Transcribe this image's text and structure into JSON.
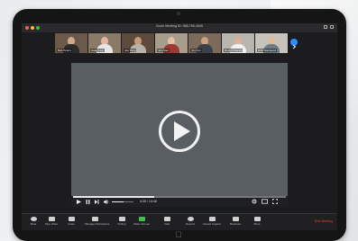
{
  "window": {
    "title": "Zoom Meeting ID: 968-795-4949"
  },
  "participants": [
    {
      "name": "Bob Peters",
      "bg": "#6b5a4c",
      "skin": "#d4a98a",
      "shirt": "#2b2b2b"
    },
    {
      "name": "Haley Lee",
      "bg": "#8a7a68",
      "skin": "#e2b79a",
      "shirt": "#e8e6e3"
    },
    {
      "name": "Joe Yang",
      "bg": "#5c4a3d",
      "skin": "#c89a7a",
      "shirt": "#b8b2aa"
    },
    {
      "name": "Jen Allen",
      "bg": "#a89c8c",
      "skin": "#e4bfa4",
      "shirt": "#9c3a32"
    },
    {
      "name": "Jon Kim",
      "bg": "#7c6b5c",
      "skin": "#cda080",
      "shirt": "#3c4048"
    },
    {
      "name": "Dustin Friends",
      "bg": "#b8b4ae",
      "skin": "#dcb094",
      "shirt": "#f2f2f2"
    },
    {
      "name": "Rick Stanwood",
      "bg": "#c6c2bc",
      "skin": "#e0b89a",
      "shirt": "#6f7a86"
    }
  ],
  "player": {
    "time": "4:35 / 14:46",
    "progress": 0.38,
    "volume": 0.55
  },
  "toolbar": {
    "buttons": [
      {
        "label": "Mute"
      },
      {
        "label": "Stop Video"
      },
      {
        "label": "Invite"
      },
      {
        "label": "Manage Participants"
      },
      {
        "label": "Polling"
      },
      {
        "label": "Share Screen"
      },
      {
        "label": "Chat"
      },
      {
        "label": "Record"
      },
      {
        "label": "Closed Caption"
      },
      {
        "label": "Breakout"
      },
      {
        "label": "More"
      }
    ],
    "end_label": "End Meeting"
  },
  "colors": {
    "accent": "#2d8cff",
    "end": "#e5423a",
    "video_bg": "#595e63"
  },
  "icons": {
    "home": "apple-logo-icon",
    "play": "play-icon"
  }
}
